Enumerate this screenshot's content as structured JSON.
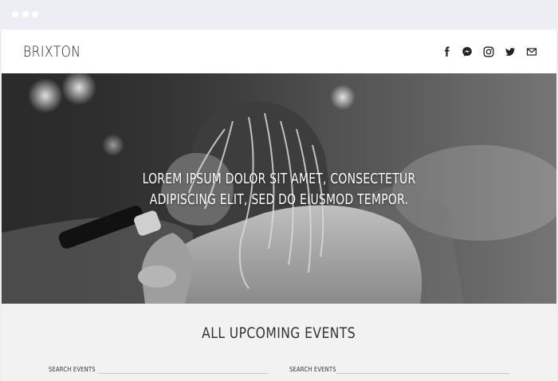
{
  "brand": {
    "name": "BRIXTON"
  },
  "social": {
    "items": [
      {
        "icon": "facebook-icon"
      },
      {
        "icon": "messenger-icon"
      },
      {
        "icon": "instagram-icon"
      },
      {
        "icon": "twitter-icon"
      },
      {
        "icon": "mail-icon"
      }
    ]
  },
  "hero": {
    "line1": "LOREM IPSUM DOLOR SIT AMET, CONSECTETUR",
    "line2": "ADIPISCING ELIT, SED DO EIUSMOD TEMPOR."
  },
  "events": {
    "title": "ALL UPCOMING EVENTS",
    "search_left_label": "SEARCH EVENTS",
    "search_right_label": "SEARCH EVENTS",
    "search_left_value": "",
    "search_right_value": ""
  },
  "colors": {
    "chrome": "#eceef3",
    "header_bg": "#ffffff",
    "section_bg": "#f2f2f2",
    "text_dark": "#222222",
    "hero_text": "#ffffff"
  }
}
